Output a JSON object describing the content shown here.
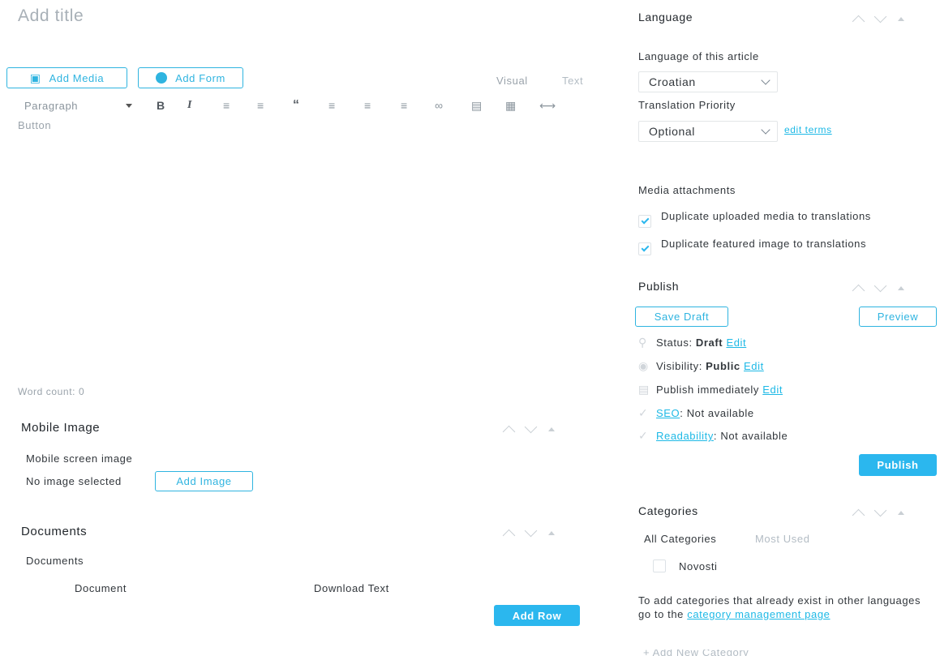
{
  "editor": {
    "title_placeholder": "Add title",
    "add_media_label": "Add Media",
    "add_form_label": "Add Form",
    "tab_visual": "Visual",
    "tab_text": "Text",
    "paragraph_select": "Paragraph",
    "content": "Button",
    "word_count": "Word count: 0"
  },
  "mobile_image": {
    "title": "Mobile Image",
    "field_label": "Mobile screen image",
    "no_image": "No image selected",
    "add_image_label": "Add Image"
  },
  "documents": {
    "title": "Documents",
    "field_label": "Documents",
    "col_document": "Document",
    "col_download_text": "Download Text",
    "add_row_label": "Add Row"
  },
  "language": {
    "title": "Language",
    "article_label": "Language of this article",
    "article_value": "Croatian",
    "priority_label": "Translation Priority",
    "priority_value": "Optional",
    "edit_terms": "edit terms",
    "media_title": "Media attachments",
    "dup_media": "Duplicate uploaded media to translations",
    "dup_featured": "Duplicate featured image to translations"
  },
  "publish": {
    "title": "Publish",
    "save_draft": "Save Draft",
    "preview": "Preview",
    "status_label": "Status: ",
    "status_value": "Draft",
    "visibility_label": "Visibility: ",
    "visibility_value": "Public",
    "publish_when": "Publish immediately",
    "edit": "Edit",
    "seo_link": "SEO",
    "seo_value": ": Not available",
    "readability_link": "Readability",
    "readability_value": ": Not available",
    "publish_button": "Publish"
  },
  "categories": {
    "title": "Categories",
    "tab_all": "All Categories",
    "tab_most_used": "Most Used",
    "item_novosti": "Novosti",
    "note_text": "To add categories that already exist in other languages go to the ",
    "note_link": "category management page",
    "add_new": "+ Add New Category"
  },
  "colors": {
    "accent": "#2bb7ee",
    "text": "#32373c"
  }
}
